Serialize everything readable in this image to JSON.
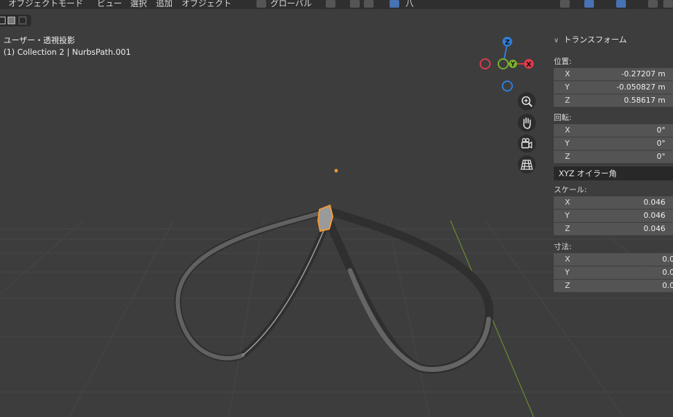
{
  "header": {
    "mode": "オブジェクトモード",
    "menus": [
      "ビュー",
      "選択",
      "追加",
      "オブジェクト"
    ],
    "transform_orientation": "グローバル",
    "pivot_label": "八"
  },
  "viewport": {
    "view_name": "ユーザー・透視投影",
    "object_info": "(1) Collection 2 | NurbsPath.001",
    "gizmo_axes": {
      "x": "X",
      "y": "Y",
      "z": "Z"
    },
    "colors": {
      "x": "#e03a4e",
      "y": "#7bb02a",
      "z": "#2f7fd9",
      "selected": "#f29b35"
    },
    "nav_icons": [
      "zoom-icon",
      "hand-pan-icon",
      "camera-icon",
      "grid-icon"
    ]
  },
  "transform_panel": {
    "title": "トランスフォーム",
    "location_label": "位置:",
    "location": [
      {
        "axis": "X",
        "value": "-0.27207 m"
      },
      {
        "axis": "Y",
        "value": "-0.050827 m"
      },
      {
        "axis": "Z",
        "value": "0.58617 m"
      }
    ],
    "rotation_label": "回転:",
    "rotation": [
      {
        "axis": "X",
        "value": "0°"
      },
      {
        "axis": "Y",
        "value": "0°"
      },
      {
        "axis": "Z",
        "value": "0°"
      }
    ],
    "rotation_mode": "XYZ オイラー角",
    "scale_label": "スケール:",
    "scale": [
      {
        "axis": "X",
        "value": "0.046"
      },
      {
        "axis": "Y",
        "value": "0.046"
      },
      {
        "axis": "Z",
        "value": "0.046"
      }
    ],
    "dimensions_label": "寸法:",
    "dimensions": [
      {
        "axis": "X",
        "value": "0.0"
      },
      {
        "axis": "Y",
        "value": "0.0"
      },
      {
        "axis": "Z",
        "value": "0.0"
      }
    ]
  }
}
